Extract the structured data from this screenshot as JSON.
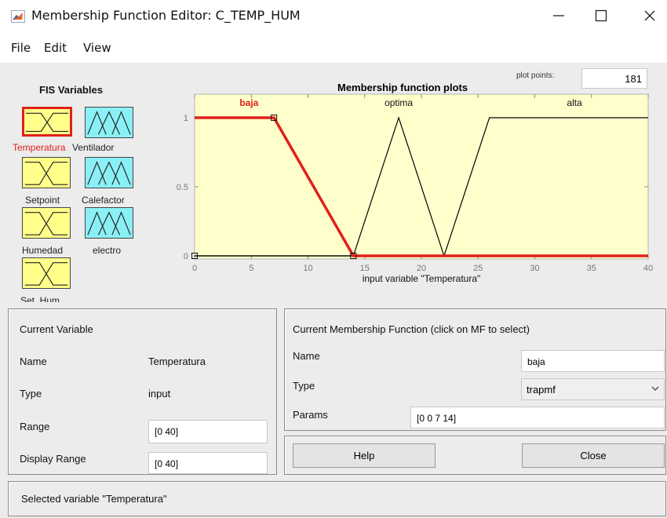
{
  "window": {
    "title": "Membership Function Editor: C_TEMP_HUM"
  },
  "menu": {
    "file": "File",
    "edit": "Edit",
    "view": "View"
  },
  "fis": {
    "heading": "FIS Variables",
    "variables": [
      {
        "label": "Temperatura",
        "kind": "input",
        "selected": true
      },
      {
        "label": "Ventilador",
        "kind": "output",
        "selected": false
      },
      {
        "label": "Setpoint",
        "kind": "input",
        "selected": false
      },
      {
        "label": "Calefactor",
        "kind": "output",
        "selected": false
      },
      {
        "label": "Humedad",
        "kind": "input",
        "selected": false
      },
      {
        "label": "electro",
        "kind": "output",
        "selected": false
      },
      {
        "label": "Set_Hum",
        "kind": "input",
        "selected": false
      }
    ]
  },
  "plot": {
    "title": "Membership function plots",
    "points_label": "plot points:",
    "points_value": "181"
  },
  "chart_data": {
    "type": "line",
    "xlabel": "input variable \"Temperatura\"",
    "xlim": [
      0,
      40
    ],
    "ylim": [
      0,
      1
    ],
    "xticks": [
      "0",
      "5",
      "10",
      "15",
      "20",
      "25",
      "30",
      "35",
      "40"
    ],
    "yticks": [
      "0",
      "0.5",
      "1"
    ],
    "background": "#ffffcc",
    "series": [
      {
        "name": "baja",
        "type": "trapmf",
        "x": [
          0,
          0,
          7,
          14,
          40
        ],
        "y": [
          1,
          1,
          1,
          0,
          0
        ],
        "color": "#e0201a",
        "selected": true
      },
      {
        "name": "optima",
        "type": "trimf",
        "x": [
          0,
          14,
          18,
          22,
          40
        ],
        "y": [
          0,
          0,
          1,
          0,
          0
        ],
        "color": "#000000",
        "selected": false
      },
      {
        "name": "alta",
        "type": "trapmf",
        "x": [
          0,
          22,
          26,
          40
        ],
        "y": [
          0,
          0,
          1,
          1
        ],
        "color": "#000000",
        "selected": false
      }
    ]
  },
  "current_variable": {
    "heading": "Current Variable",
    "name_label": "Name",
    "name_value": "Temperatura",
    "type_label": "Type",
    "type_value": "input",
    "range_label": "Range",
    "range_value": "[0 40]",
    "display_range_label": "Display Range",
    "display_range_value": "[0 40]"
  },
  "current_mf": {
    "heading": "Current Membership Function (click on MF to select)",
    "name_label": "Name",
    "name_value": "baja",
    "type_label": "Type",
    "type_value": "trapmf",
    "params_label": "Params",
    "params_value": "[0 0 7 14]"
  },
  "buttons": {
    "help": "Help",
    "close": "Close"
  },
  "status": {
    "text": "Selected variable \"Temperatura\""
  },
  "colors": {
    "selected": "#e0201a",
    "input_tile": "#ffff8a",
    "output_tile": "#8af0f5",
    "panel_bg": "#ececec"
  }
}
